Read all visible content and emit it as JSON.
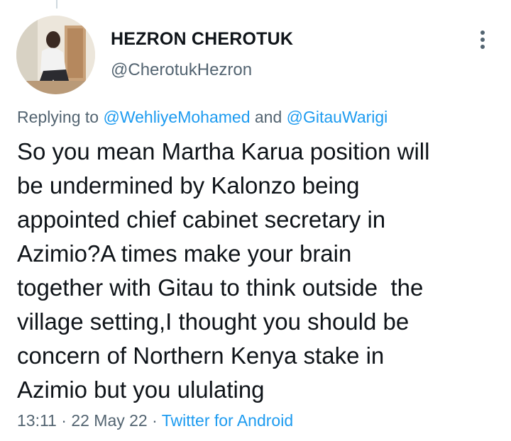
{
  "tweet": {
    "display_name": "HEZRON CHEROTUK",
    "handle": "@CherotukHezron",
    "replying_prefix": "Replying to ",
    "reply_mention_1": "@WehliyeMohamed",
    "reply_and": " and ",
    "reply_mention_2": "@GitauWarigi",
    "text_lines": [
      "So you mean Martha Karua position will",
      "be undermined by Kalonzo being",
      "appointed chief cabinet secretary in",
      "Azimio?A times make your brain",
      "together with Gitau to think outside  the",
      "village setting,I thought you should be",
      "concern of Northern Kenya stake in",
      "Azimio but you ululating"
    ],
    "time": "13:11",
    "separator": " · ",
    "date": "22 May 22",
    "source": "Twitter for Android"
  },
  "icons": {
    "more": "more-vertical-icon",
    "avatar": "profile-photo"
  },
  "colors": {
    "link": "#1d9bf0",
    "secondary_text": "#536471",
    "primary_text": "#0f1419"
  }
}
